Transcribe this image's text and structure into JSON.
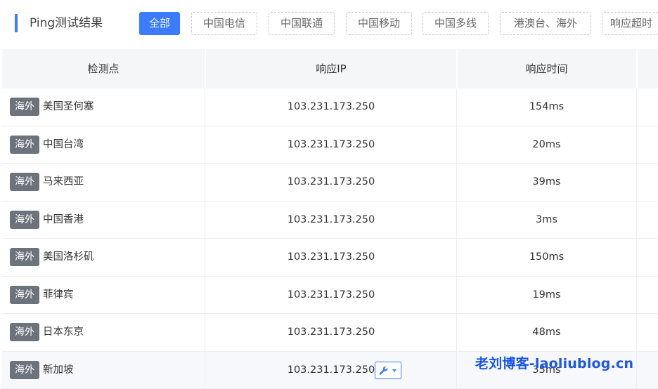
{
  "section": {
    "title": "Ping测试结果"
  },
  "filters": [
    {
      "label": "全部",
      "active": true
    },
    {
      "label": "中国电信",
      "active": false
    },
    {
      "label": "中国联通",
      "active": false
    },
    {
      "label": "中国移动",
      "active": false
    },
    {
      "label": "中国多线",
      "active": false
    },
    {
      "label": "港澳台、海外",
      "active": false
    },
    {
      "label": "响应超时",
      "active": false
    }
  ],
  "table": {
    "columns": [
      "检测点",
      "响应IP",
      "响应时间"
    ],
    "rows": [
      {
        "badge": "海外",
        "location": "美国圣何塞",
        "ip": "103.231.173.250",
        "time": "154ms"
      },
      {
        "badge": "海外",
        "location": "中国台湾",
        "ip": "103.231.173.250",
        "time": "20ms"
      },
      {
        "badge": "海外",
        "location": "马来西亚",
        "ip": "103.231.173.250",
        "time": "39ms"
      },
      {
        "badge": "海外",
        "location": "中国香港",
        "ip": "103.231.173.250",
        "time": "3ms"
      },
      {
        "badge": "海外",
        "location": "美国洛杉矶",
        "ip": "103.231.173.250",
        "time": "150ms"
      },
      {
        "badge": "海外",
        "location": "菲律宾",
        "ip": "103.231.173.250",
        "time": "19ms"
      },
      {
        "badge": "海外",
        "location": "日本东京",
        "ip": "103.231.173.250",
        "time": "48ms"
      },
      {
        "badge": "海外",
        "location": "新加坡",
        "ip": "103.231.173.250",
        "time": "35ms"
      }
    ]
  },
  "tool_icon": "wrench-icon",
  "watermark": "老刘博客-laoliublog.cn",
  "colors": {
    "accent": "#3a7bff",
    "badge": "#6d737d",
    "watermark": "#1a56e8"
  }
}
